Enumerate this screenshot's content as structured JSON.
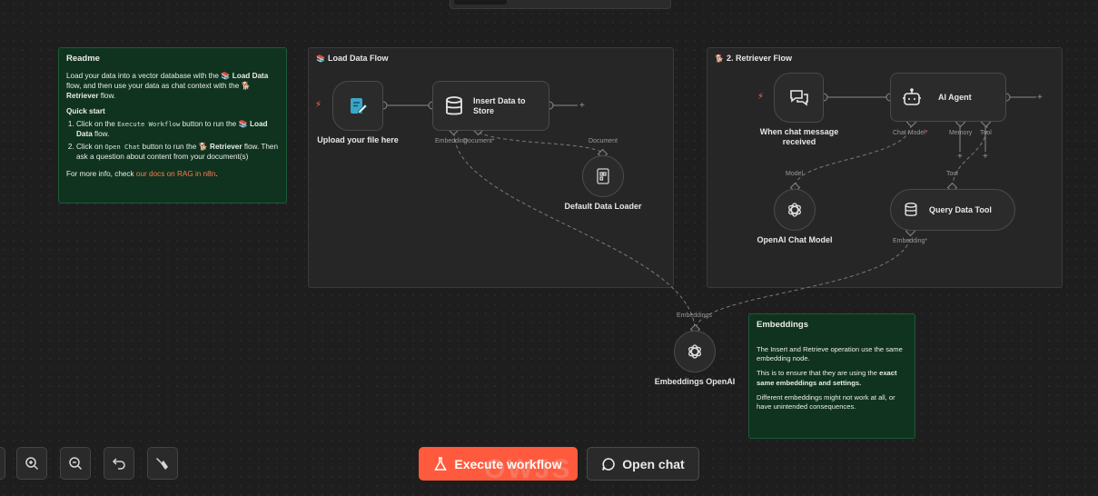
{
  "readme": {
    "title": "Readme",
    "intro_1": "Load your data into a vector database with the",
    "intro_emoji_1": "📚",
    "intro_link_1": "Load Data",
    "intro_2": "flow, and then use your data as chat context with the",
    "intro_emoji_2": "🐕",
    "intro_link_2": "Retriever",
    "intro_3": "flow.",
    "quick_start": "Quick start",
    "step1_a": "Click on the",
    "step1_code": "Execute Workflow",
    "step1_b": "button to run the",
    "step1_emoji": "📚",
    "step1_c": "Load Data",
    "step1_d": "flow.",
    "step2_a": "Click on",
    "step2_code": "Open Chat",
    "step2_b": "button to run the",
    "step2_emoji": "🐕",
    "step2_c": "Retriever",
    "step2_d": "flow. Then ask a question about content from your document(s)",
    "more_a": "For more info, check",
    "more_link": "our docs on RAG in n8n",
    "more_b": "."
  },
  "load_group": {
    "emoji": "📚",
    "title": "Load Data Flow"
  },
  "retriever_group": {
    "emoji": "🐕",
    "title": "2. Retriever Flow"
  },
  "nodes": {
    "upload": {
      "label": "Upload your file here",
      "icon": "form-icon"
    },
    "insert": {
      "label": "Insert Data to Store",
      "icon": "database-icon",
      "port_embedding": "Embedding",
      "port_document": "Document",
      "required": "*"
    },
    "loader": {
      "label": "Default Data Loader",
      "icon": "file-icon",
      "port_document": "Document"
    },
    "chat_trigger": {
      "label": "When chat message received",
      "icon": "chat-icon"
    },
    "agent": {
      "label": "AI Agent",
      "icon": "robot-icon",
      "port_chat": "Chat Model",
      "port_memory": "Memory",
      "port_tool": "Tool",
      "required": "*"
    },
    "openai_chat": {
      "label": "OpenAI Chat Model",
      "icon": "openai-icon",
      "port_model": "Model"
    },
    "query_tool": {
      "label": "Query Data Tool",
      "icon": "database-icon",
      "port_tool": "Tool",
      "port_embedding": "Embedding",
      "required": "*"
    },
    "embeddings": {
      "label": "Embeddings OpenAI",
      "icon": "openai-icon",
      "port_embeddings": "Embeddings"
    }
  },
  "embeddings_note": {
    "title": "Embeddings",
    "p1": "The Insert and Retrieve operation use the same embedding node.",
    "p2_a": "This is to ensure that they are using the",
    "p2_b": "exact same embeddings and settings.",
    "p3": "Different embeddings might not work at all, or have unintended consequences."
  },
  "toolbar": {
    "execute": "Execute workflow",
    "open_chat": "Open chat",
    "watermark": "OWJS"
  },
  "colors": {
    "accent": "#ff5a3d",
    "sticky_bg": "#10331f",
    "required": "#ff6d5a"
  }
}
